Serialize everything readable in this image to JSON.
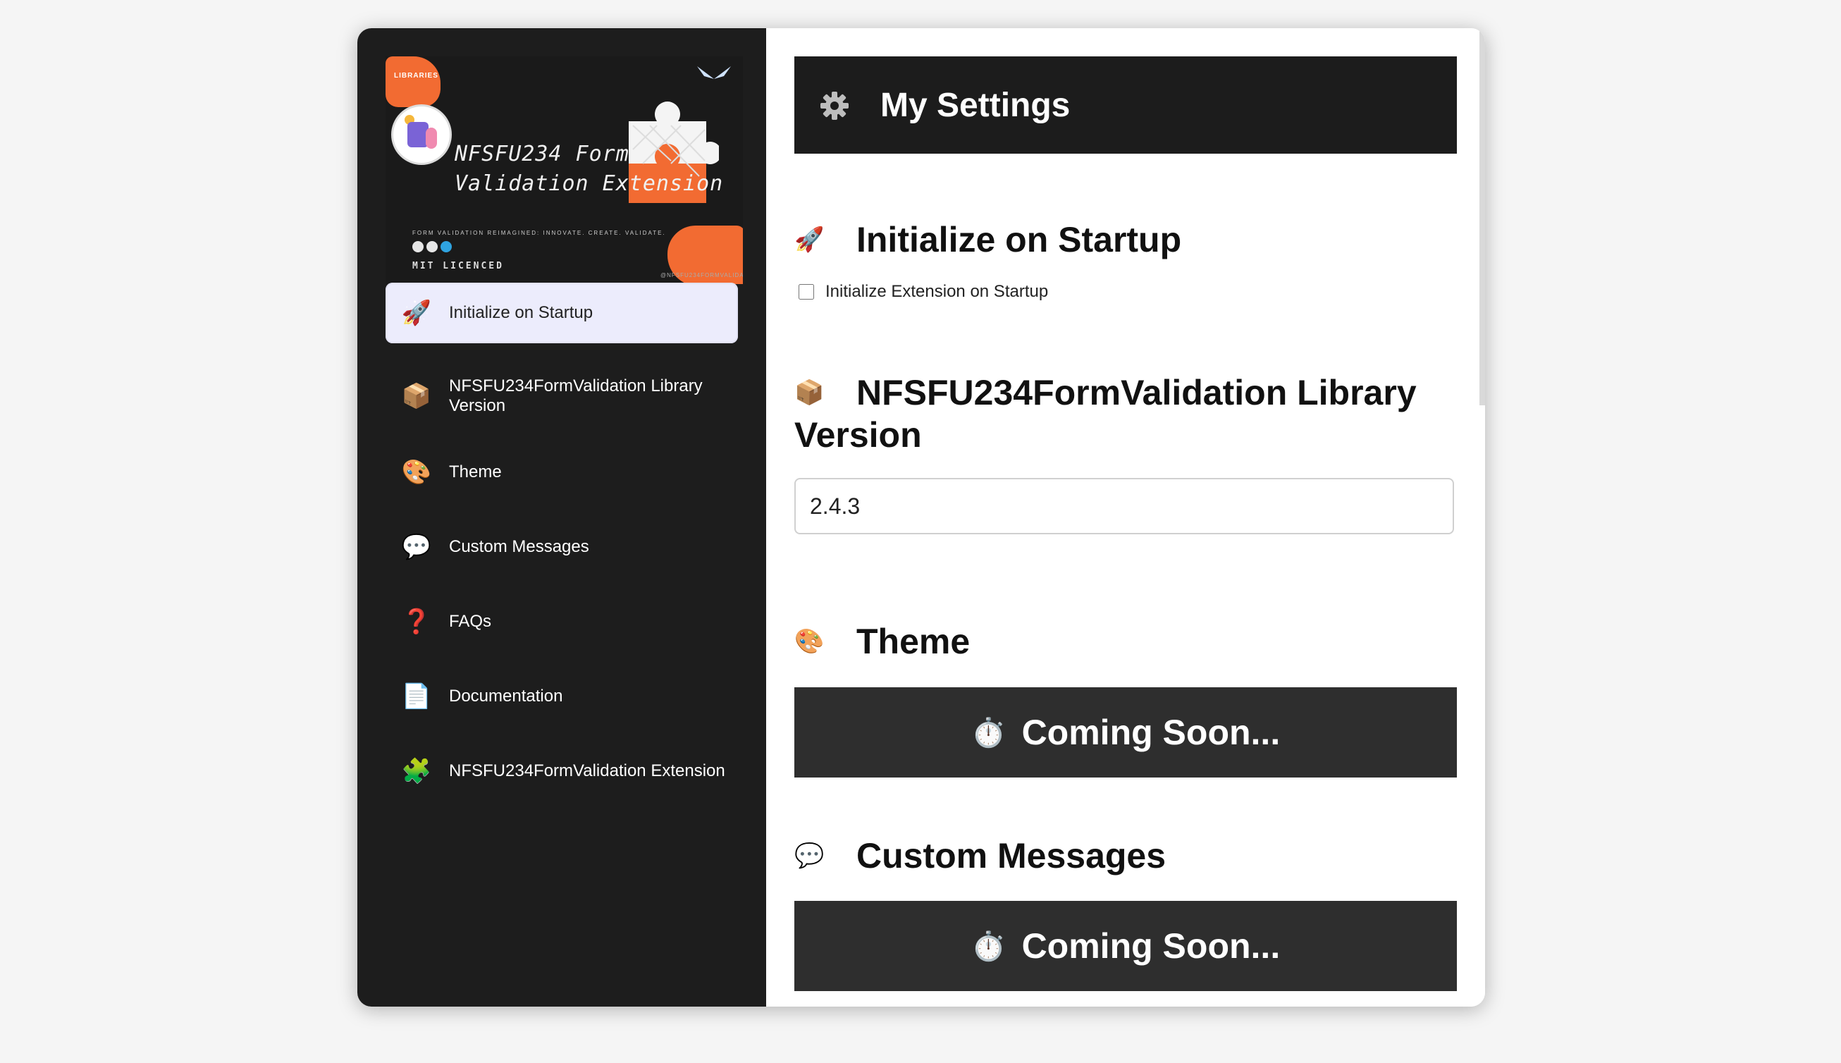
{
  "banner": {
    "title_line1": "NFSFU234 Form",
    "title_line2": "Validation Extension",
    "tagline": "FORM VALIDATION REIMAGINED: INNOVATE. CREATE. VALIDATE.",
    "license": "MIT LICENCED",
    "brand_small": "LIBRARIES",
    "social": "@NFSFU234FORMVALIDATION"
  },
  "sidebar": {
    "items": [
      {
        "label": "Initialize on Startup",
        "icon": "rocket-icon",
        "glyph": "🚀",
        "active": true
      },
      {
        "label": "NFSFU234FormValidation Library Version",
        "icon": "package-icon",
        "glyph": "📦",
        "active": false
      },
      {
        "label": "Theme",
        "icon": "palette-icon",
        "glyph": "🎨",
        "active": false
      },
      {
        "label": "Custom Messages",
        "icon": "speech-bubble-icon",
        "glyph": "💬",
        "active": false
      },
      {
        "label": "FAQs",
        "icon": "question-mark-icon",
        "glyph": "❓",
        "active": false
      },
      {
        "label": "Documentation",
        "icon": "document-icon",
        "glyph": "📄",
        "active": false
      },
      {
        "label": "NFSFU234FormValidation Extension",
        "icon": "puzzle-piece-icon",
        "glyph": "🧩",
        "active": false
      }
    ]
  },
  "header": {
    "title": "My Settings",
    "icon": "gear-icon"
  },
  "sections": {
    "startup": {
      "title": "Initialize on Startup",
      "glyph": "🚀",
      "checkbox_label": "Initialize Extension on Startup",
      "checked": false
    },
    "version": {
      "title": "NFSFU234FormValidation Library Version",
      "glyph": "📦",
      "value": "2.4.3"
    },
    "theme": {
      "title": "Theme",
      "glyph": "🎨",
      "coming_soon": "Coming Soon...",
      "timer_glyph": "⏱️"
    },
    "messages": {
      "title": "Custom Messages",
      "glyph": "💬",
      "coming_soon": "Coming Soon...",
      "timer_glyph": "⏱️"
    }
  },
  "colors": {
    "sidebar_bg": "#1d1d1d",
    "active_item_bg": "#ececfc",
    "header_bg": "#1c1c1c",
    "coming_soon_bg": "#2e2e2e",
    "accent_orange": "#f26b32"
  }
}
